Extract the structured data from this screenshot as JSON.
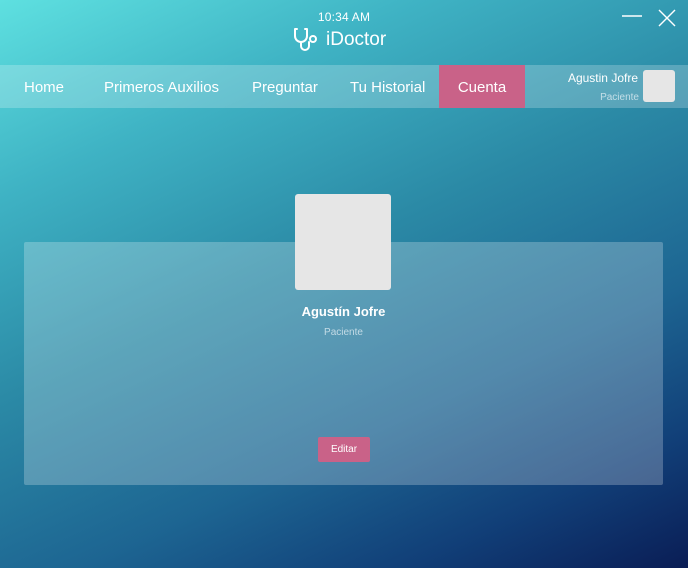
{
  "window": {
    "time": "10:34 AM",
    "app_name": "iDoctor",
    "icons": {
      "logo": "stethoscope-icon",
      "minimize": "minimize-icon",
      "close": "close-icon"
    }
  },
  "nav": {
    "items": [
      {
        "label": "Home",
        "active": false
      },
      {
        "label": "Primeros Auxilios",
        "active": false
      },
      {
        "label": "Preguntar",
        "active": false
      },
      {
        "label": "Tu Historial",
        "active": false
      },
      {
        "label": "Cuenta",
        "active": true
      }
    ],
    "user": {
      "name": "Agustin Jofre",
      "role": "Paciente"
    }
  },
  "profile": {
    "name": "Agustín Jofre",
    "role": "Paciente",
    "edit_label": "Editar"
  },
  "colors": {
    "accent": "#c96288",
    "gradient_start": "#5ee0e0",
    "gradient_end": "#0a1d55",
    "avatar_placeholder": "#e6e6e6"
  }
}
